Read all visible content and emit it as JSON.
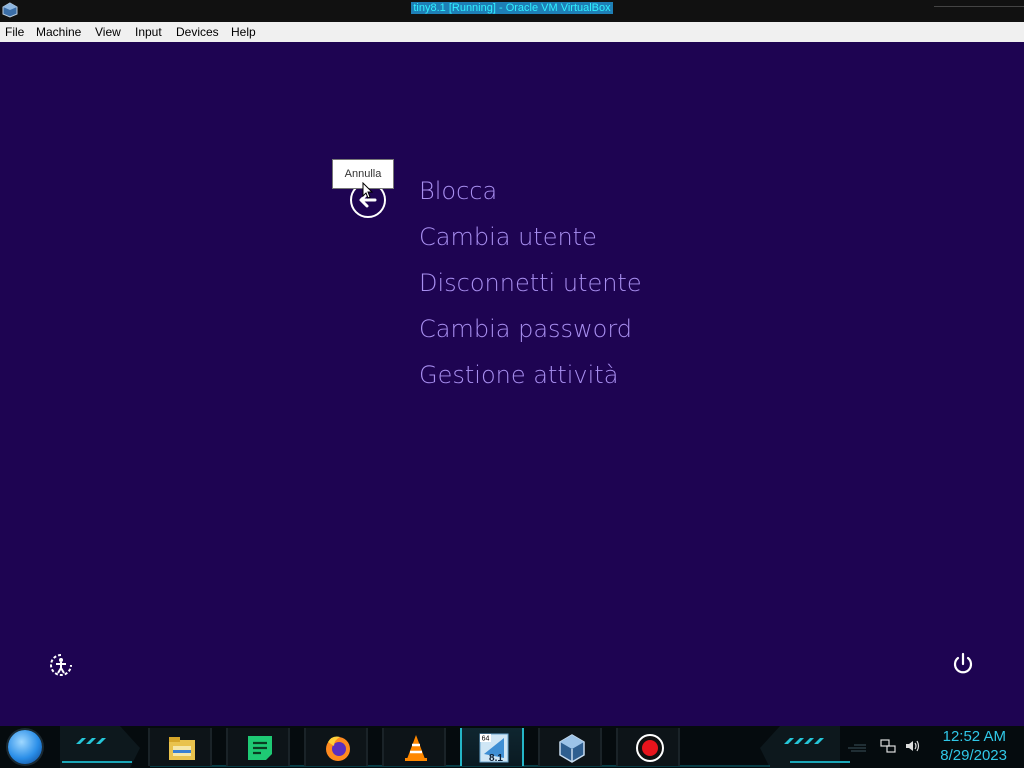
{
  "window": {
    "title": "tiny8.1 [Running] - Oracle VM VirtualBox",
    "app_icon": "virtualbox-icon"
  },
  "menubar": {
    "items": [
      {
        "label": "File"
      },
      {
        "label": "Machine"
      },
      {
        "label": "View"
      },
      {
        "label": "Input"
      },
      {
        "label": "Devices"
      },
      {
        "label": "Help"
      }
    ]
  },
  "security_screen": {
    "background": "#1e0452",
    "accent": "#a88ff0",
    "back_tooltip": "Annulla",
    "options": [
      {
        "label": "Blocca"
      },
      {
        "label": "Cambia utente"
      },
      {
        "label": "Disconnetti utente"
      },
      {
        "label": "Cambia password"
      },
      {
        "label": "Gestione attività"
      }
    ],
    "icons": {
      "back": "back-arrow-icon",
      "ease_of_access": "ease-of-access-icon",
      "power": "power-icon"
    }
  },
  "taskbar": {
    "start": "start-orb-icon",
    "apps": [
      {
        "name": "file-explorer-icon"
      },
      {
        "name": "notes-app-icon"
      },
      {
        "name": "firefox-icon"
      },
      {
        "name": "vlc-icon"
      },
      {
        "name": "windows-8.1-vm-icon",
        "badge_top": "64",
        "badge_bottom": "8.1"
      },
      {
        "name": "virtualbox-icon"
      },
      {
        "name": "screen-recorder-icon"
      }
    ],
    "tray_icons": [
      "network-icon",
      "volume-icon"
    ],
    "clock": {
      "time": "12:52 AM",
      "date": "8/29/2023"
    },
    "accent": "#30c8e8"
  }
}
